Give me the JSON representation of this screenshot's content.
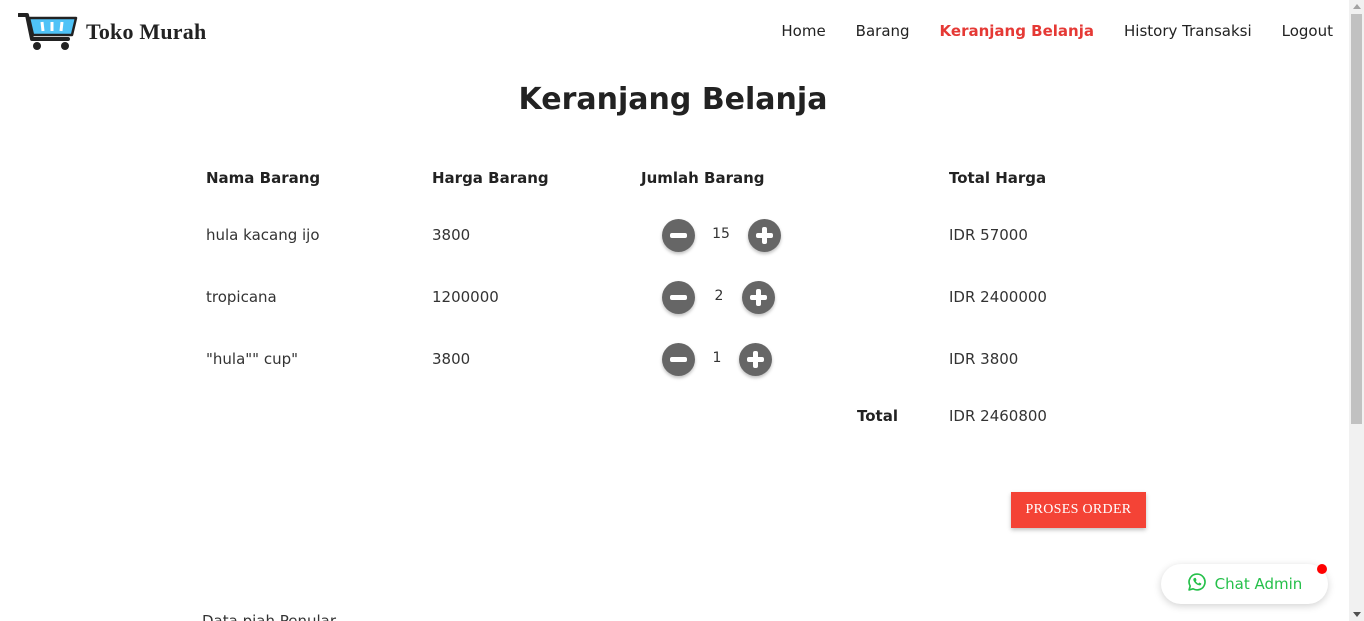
{
  "brand": {
    "name": "Toko Murah",
    "logo_icon": "shopping-cart-icon",
    "logo_color": "#4fc3f7"
  },
  "nav": {
    "items": [
      {
        "label": "Home"
      },
      {
        "label": "Barang"
      },
      {
        "label": "Keranjang Belanja",
        "active": true
      },
      {
        "label": "History Transaksi"
      },
      {
        "label": "Logout"
      }
    ],
    "active_color": "#e53935"
  },
  "page_title": "Keranjang Belanja",
  "table": {
    "headers": [
      "Nama Barang",
      "Harga Barang",
      "Jumlah Barang",
      "Total Harga"
    ],
    "rows": [
      {
        "name": "hula kacang ijo",
        "price": "3800",
        "qty": "15",
        "total": "IDR 57000"
      },
      {
        "name": "tropicana",
        "price": "1200000",
        "qty": "2",
        "total": "IDR 2400000"
      },
      {
        "name": "\"hula\"\" cup\"",
        "price": "3800",
        "qty": "1",
        "total": "IDR 3800"
      }
    ],
    "total_label": "Total",
    "total_value": "IDR 2460800"
  },
  "order_button": {
    "label": "PROSES ORDER",
    "color": "#f44336"
  },
  "chat": {
    "label": "Chat Admin",
    "icon": "whatsapp-icon",
    "color": "#25c04a",
    "badge_color": "#ff0000"
  },
  "footer_peek": "Data piah Penular"
}
